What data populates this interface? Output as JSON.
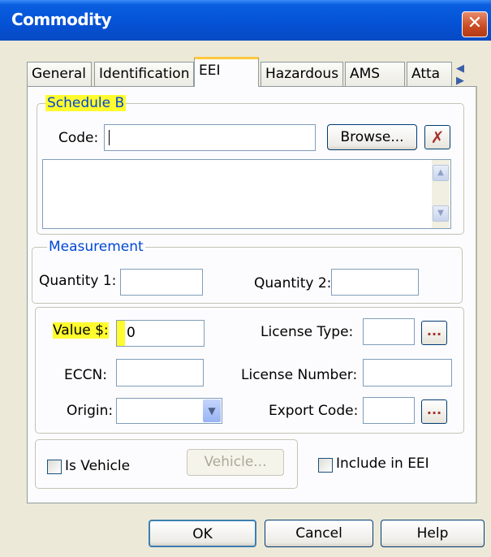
{
  "window": {
    "title": "Commodity",
    "close_glyph": "✕"
  },
  "tabs": [
    {
      "label": "General"
    },
    {
      "label": "Identification"
    },
    {
      "label": "EEI"
    },
    {
      "label": "Hazardous"
    },
    {
      "label": "AMS"
    },
    {
      "label": "Atta"
    }
  ],
  "tab_arrows": "◀ ▶",
  "schedule_b": {
    "legend": "Schedule B",
    "code_label": "Code:",
    "code_value": "",
    "browse_label": "Browse...",
    "clear_glyph": "✗",
    "description_value": ""
  },
  "measurement": {
    "legend": "Measurement",
    "quantity1_label": "Quantity 1:",
    "quantity1_value": "",
    "quantity2_label": "Quantity 2:",
    "quantity2_value": ""
  },
  "details": {
    "value_label": "Value $:",
    "value_value": "0",
    "eccn_label": "ECCN:",
    "eccn_value": "",
    "origin_label": "Origin:",
    "origin_value": "",
    "license_type_label": "License Type:",
    "license_type_value": "",
    "license_number_label": "License Number:",
    "license_number_value": "",
    "export_code_label": "Export Code:",
    "export_code_value": "",
    "ellipsis": "..."
  },
  "vehicle": {
    "is_vehicle_label": "Is Vehicle",
    "vehicle_button": "Vehicle...",
    "include_eei_label": "Include in EEI"
  },
  "footer": {
    "ok": "OK",
    "cancel": "Cancel",
    "help": "Help"
  },
  "colors": {
    "highlight": "#fffb2e",
    "titlebar": "#0553d6",
    "legend": "#0046d5"
  }
}
